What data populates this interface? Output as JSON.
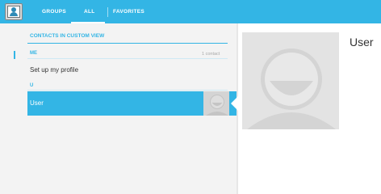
{
  "actionbar": {
    "tabs": [
      {
        "label": "GROUPS"
      },
      {
        "label": "ALL"
      },
      {
        "label": "FAVORITES"
      }
    ],
    "selected_tab": "ALL",
    "accent_color": "#33b5e5"
  },
  "list": {
    "header": "CONTACTS IN CUSTOM VIEW",
    "me_section": {
      "label": "ME",
      "count": "1 contact"
    },
    "setup_profile": "Set up my profile",
    "u_section": {
      "label": "U"
    },
    "contacts": [
      {
        "name": "User",
        "selected": true
      }
    ]
  },
  "detail": {
    "name": "User",
    "photo": "default-contact-avatar"
  }
}
